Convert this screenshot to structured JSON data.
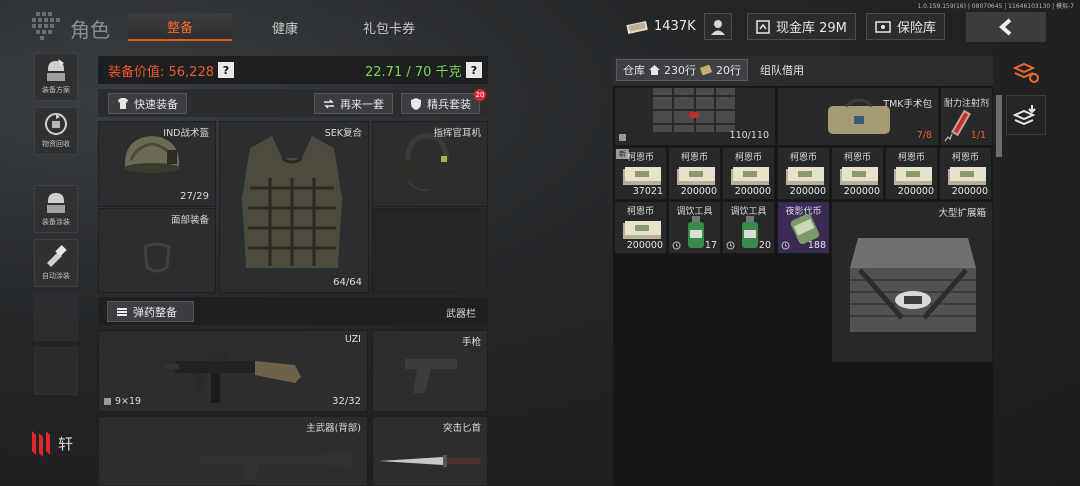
{
  "version": "1.0.159.159(16) | 08070645 | 11646103130 | 模拟-7",
  "header": {
    "title": "角色",
    "tabs": [
      {
        "label": "整备",
        "active": true
      },
      {
        "label": "健康",
        "active": false
      },
      {
        "label": "礼包卡券",
        "active": false
      }
    ],
    "currency": "1437K",
    "cash_vault": "现金库 29M",
    "safe": "保险库"
  },
  "sidebar": {
    "items": [
      {
        "label": "装备方案",
        "icon": "preset-icon"
      },
      {
        "label": "物资回收",
        "icon": "recycle-icon"
      },
      {
        "label": "装备涂装",
        "icon": "paint-icon"
      },
      {
        "label": "自动涂装",
        "icon": "auto-paint-icon"
      }
    ],
    "brand": "轩"
  },
  "equipment": {
    "value_label": "装备价值: 56,228",
    "weight_label": "22.71 / 70 千克",
    "quick_equip": "快速装备",
    "again": "再来一套",
    "elite": "精兵套装",
    "elite_badge": "20",
    "helmet": {
      "name": "IND战术盔",
      "value": "27/29"
    },
    "face": {
      "name": "面部装备"
    },
    "armor": {
      "name": "SEK复合",
      "value": "64/64"
    },
    "headset": {
      "name": "指挥官耳机"
    },
    "ammo_button": "弹药整备",
    "weapon_bar": "武器栏",
    "smg": {
      "name": "UZI",
      "caliber": "9×19",
      "ammo": "32/32"
    },
    "pistol": {
      "name": "手枪"
    },
    "primary": {
      "name": "主武器(背部)"
    },
    "melee": {
      "name": "突击匕首"
    }
  },
  "warehouse": {
    "tab_warehouse": "仓库",
    "rows_a": "230行",
    "rows_b": "20行",
    "tab_team": "组队借用",
    "vest_value": "110/110",
    "bag": {
      "name": "TMK手术包",
      "count": "7/8"
    },
    "syringe": {
      "name": "耐力注射剂",
      "count": "1/1"
    },
    "row1": [
      {
        "name": "柯恩币",
        "count": "37021",
        "new": true
      },
      {
        "name": "柯恩币",
        "count": "200000"
      },
      {
        "name": "柯恩币",
        "count": "200000"
      },
      {
        "name": "柯恩币",
        "count": "200000"
      },
      {
        "name": "柯恩币",
        "count": "200000"
      },
      {
        "name": "柯恩币",
        "count": "200000"
      },
      {
        "name": "柯恩币",
        "count": "200000"
      }
    ],
    "row2": [
      {
        "name": "柯恩币",
        "count": "200000"
      },
      {
        "name": "调饮工具",
        "count": "17"
      },
      {
        "name": "调饮工具",
        "count": "20"
      },
      {
        "name": "夜影代币",
        "count": "188"
      }
    ],
    "case": {
      "name": "大型扩展箱"
    },
    "new_badge": "新"
  },
  "colors": {
    "accent": "#f06a2a",
    "weight_green": "#7ed64a",
    "night_token_bg": "#3b2a55"
  }
}
